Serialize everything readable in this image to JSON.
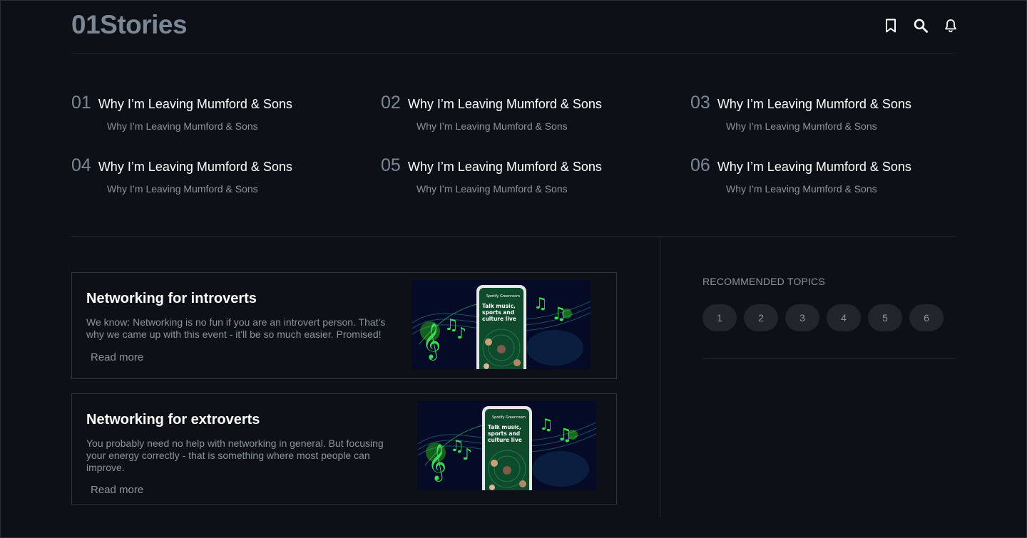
{
  "brand": {
    "logo": "01Stories"
  },
  "header": {
    "icons": [
      "bookmark-icon",
      "search-icon",
      "bell-icon"
    ]
  },
  "trending": [
    {
      "num": "01",
      "title": "Why I’m Leaving Mumford & Sons",
      "subtitle": "Why I’m Leaving Mumford & Sons"
    },
    {
      "num": "02",
      "title": "Why I’m Leaving Mumford & Sons",
      "subtitle": "Why I’m Leaving Mumford & Sons"
    },
    {
      "num": "03",
      "title": "Why I’m Leaving Mumford & Sons",
      "subtitle": "Why I’m Leaving Mumford & Sons"
    },
    {
      "num": "04",
      "title": "Why I’m Leaving Mumford & Sons",
      "subtitle": "Why I’m Leaving Mumford & Sons"
    },
    {
      "num": "05",
      "title": "Why I’m Leaving Mumford & Sons",
      "subtitle": "Why I’m Leaving Mumford & Sons"
    },
    {
      "num": "06",
      "title": "Why I’m Leaving Mumford & Sons",
      "subtitle": "Why I’m Leaving Mumford & Sons"
    }
  ],
  "articles": [
    {
      "title": "Networking for introverts",
      "description": "We know: Networking is no fun if you are an introvert person. That's why we came up with this event - it'll be so much easier. Promised!",
      "read_more": "Read more",
      "image": {
        "phone_brand": "Spotify Greenroom",
        "phone_text_1": "Talk music,",
        "phone_text_2": "sports and",
        "phone_text_3": "culture live"
      }
    },
    {
      "title": "Networking for extroverts",
      "description": "You probably need no help with networking in general. But focusing your energy correctly - that is something where most people can improve.",
      "read_more": "Read more",
      "image": {
        "phone_brand": "Spotify Greenroom",
        "phone_text_1": "Talk music,",
        "phone_text_2": "sports and",
        "phone_text_3": "culture live"
      }
    }
  ],
  "sidebar": {
    "label": "RECOMMENDED TOPICS",
    "topics": [
      "1",
      "2",
      "3",
      "4",
      "5",
      "6"
    ]
  },
  "colors": {
    "background": "#0d1117",
    "muted": "#8b949e",
    "logo": "#7b8794",
    "pill": "#21262d",
    "neon_green": "#39ff14"
  }
}
